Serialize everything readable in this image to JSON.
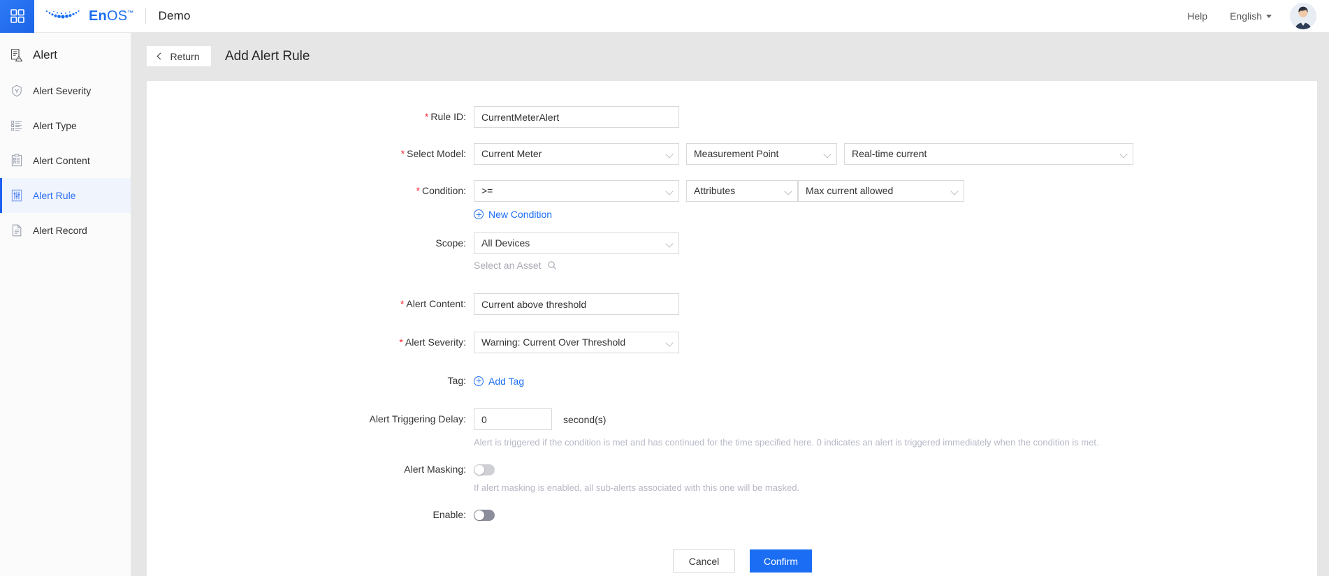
{
  "topbar": {
    "app_switcher_icon": "grid-apps-icon",
    "brand": {
      "name_part1": "En",
      "name_part2": "OS",
      "trademark": "™"
    },
    "workspace": "Demo",
    "help_label": "Help",
    "language_label": "English",
    "avatar_icon": "user-avatar"
  },
  "sidebar": {
    "title": "Alert",
    "title_icon": "alert-document-icon",
    "items": [
      {
        "label": "Alert Severity",
        "icon": "severity-badge-icon",
        "active": false
      },
      {
        "label": "Alert Type",
        "icon": "list-icon",
        "active": false
      },
      {
        "label": "Alert Content",
        "icon": "clipboard-icon",
        "active": false
      },
      {
        "label": "Alert Rule",
        "icon": "sliders-icon",
        "active": true
      },
      {
        "label": "Alert Record",
        "icon": "file-icon",
        "active": false
      }
    ]
  },
  "page": {
    "return_label": "Return",
    "title": "Add Alert Rule"
  },
  "form": {
    "rule_id": {
      "label": "Rule ID:",
      "required": true,
      "value": "CurrentMeterAlert",
      "placeholder": ""
    },
    "select_model": {
      "label": "Select Model:",
      "required": true,
      "model": "Current Meter",
      "category": "Measurement Point",
      "point": "Real-time current"
    },
    "condition": {
      "label": "Condition:",
      "required": true,
      "operator": ">=",
      "source": "Attributes",
      "target": "Max current allowed",
      "new_condition_label": "New Condition"
    },
    "scope": {
      "label": "Scope:",
      "required": false,
      "value": "All Devices",
      "asset_placeholder": "Select an Asset",
      "asset_icon": "search-icon"
    },
    "alert_content": {
      "label": "Alert Content:",
      "required": true,
      "value": "Current above threshold"
    },
    "alert_severity": {
      "label": "Alert Severity:",
      "required": true,
      "value": "Warning: Current Over Threshold"
    },
    "tag": {
      "label": "Tag:",
      "required": false,
      "add_label": "Add Tag"
    },
    "trigger_delay": {
      "label": "Alert Triggering Delay:",
      "required": false,
      "value": "0",
      "unit": "second(s)",
      "hint": "Alert is triggered if the condition is met and has continued for the time specified here. 0 indicates an alert is triggered immediately when the condition is met."
    },
    "alert_masking": {
      "label": "Alert Masking:",
      "required": false,
      "state": "off",
      "hint": "If alert masking is enabled, all sub-alerts associated with this one will be masked."
    },
    "enable": {
      "label": "Enable:",
      "required": false,
      "state": "off"
    },
    "actions": {
      "cancel_label": "Cancel",
      "confirm_label": "Confirm"
    }
  },
  "colors": {
    "accent": "#1b6ef3",
    "required_star": "#f5222d",
    "page_background": "#e6e6e6",
    "sidebar_active_bg": "#f0f4fd"
  }
}
